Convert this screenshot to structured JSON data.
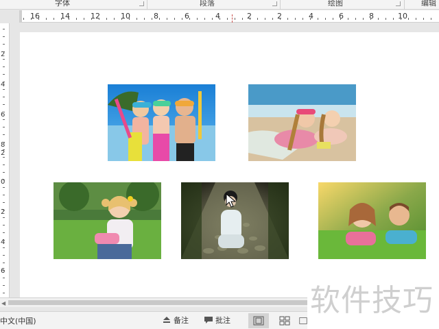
{
  "ribbon": {
    "groups": [
      "字体",
      "段落",
      "绘图",
      "编辑"
    ]
  },
  "ruler": {
    "horizontal_labels": [
      "16",
      "14",
      "12",
      "10",
      "8",
      "6",
      "4",
      "2",
      "2",
      "4",
      "6",
      "8",
      "10"
    ],
    "vertical_labels": [
      "2",
      "4",
      "6",
      "8",
      "2",
      "0",
      "2",
      "4",
      "6",
      "8"
    ]
  },
  "photos": [
    {
      "name": "kids-with-snorkels-photo",
      "description": "three kids with snorkel masks"
    },
    {
      "name": "girls-on-beach-photo",
      "description": "two girls lying on beach"
    },
    {
      "name": "girl-on-grass-photo",
      "description": "blonde girl sitting on grass"
    },
    {
      "name": "girl-on-cobblestone-photo",
      "description": "girl crouching on cobblestone path"
    },
    {
      "name": "kids-lying-on-grass-photo",
      "description": "two kids lying on grass"
    }
  ],
  "statusbar": {
    "language": "中文(中国)",
    "notes_label": "备注",
    "comments_label": "批注"
  },
  "watermark": "软件技巧"
}
